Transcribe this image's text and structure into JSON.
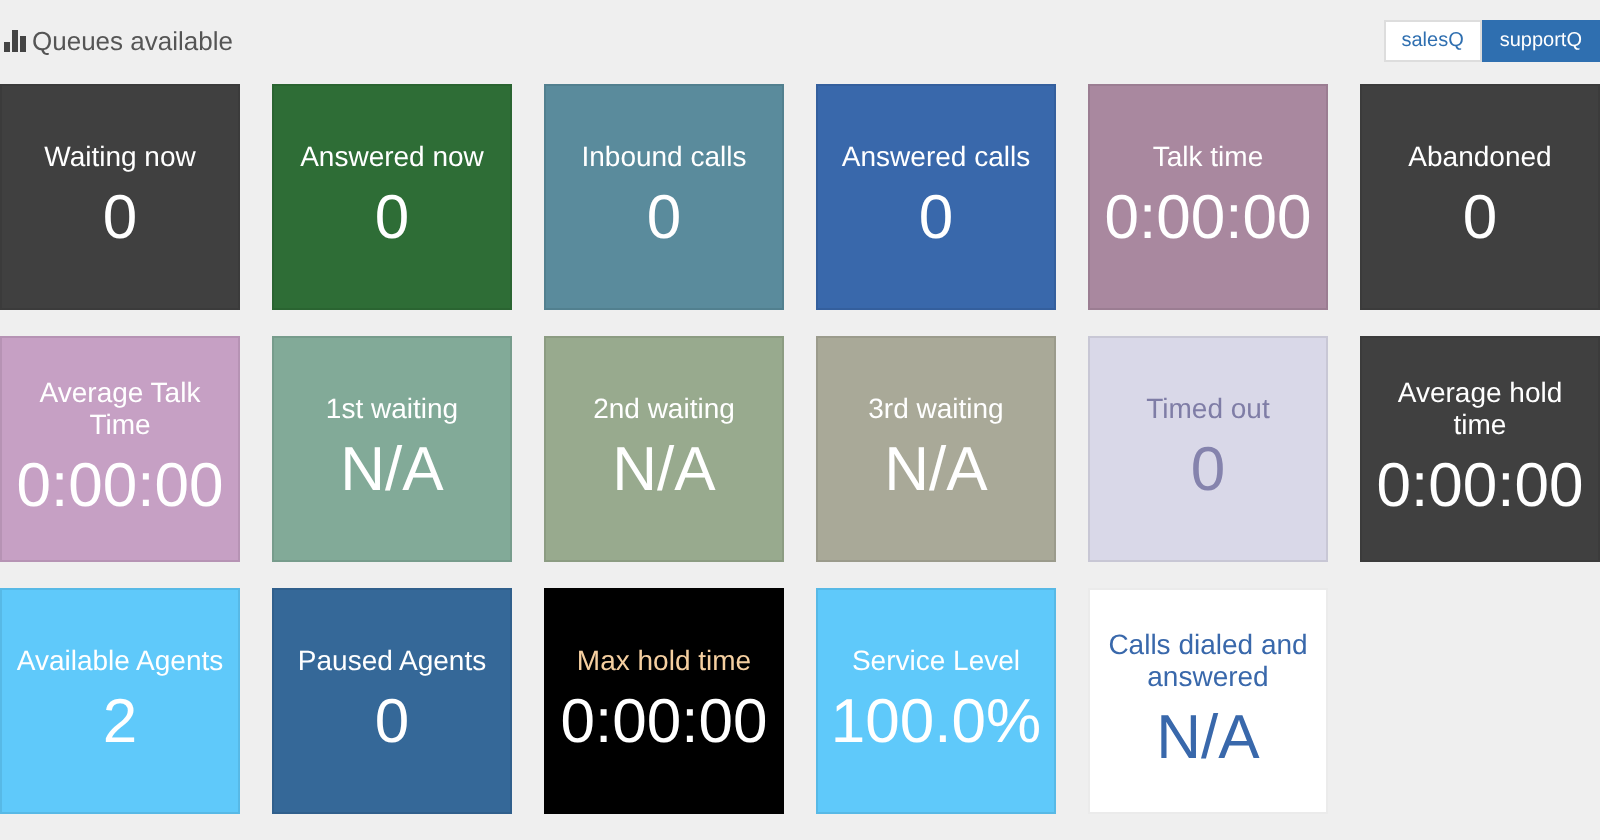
{
  "header": {
    "title": "Queues available"
  },
  "queues": [
    {
      "label": "salesQ",
      "selected": false
    },
    {
      "label": "supportQ",
      "selected": true
    }
  ],
  "tiles": [
    {
      "label": "Waiting now",
      "value": "0",
      "color": "#404040",
      "kind": "plain"
    },
    {
      "label": "Answered now",
      "value": "0",
      "color": "#2e6d36",
      "kind": "plain"
    },
    {
      "label": "Inbound calls",
      "value": "0",
      "color": "#5a8b9c",
      "kind": "plain"
    },
    {
      "label": "Answered calls",
      "value": "0",
      "color": "#3968ab",
      "kind": "plain"
    },
    {
      "label": "Talk time",
      "value": "0:00:00",
      "color": "#a9889f",
      "kind": "plain"
    },
    {
      "label": "Abandoned",
      "value": "0",
      "color": "#404040",
      "kind": "plain"
    },
    {
      "label": "Average Talk Time",
      "value": "0:00:00",
      "color": "#c6a0c4",
      "kind": "plain"
    },
    {
      "label": "1st waiting",
      "value": "N/A",
      "color": "#82aa98",
      "kind": "plain"
    },
    {
      "label": "2nd waiting",
      "value": "N/A",
      "color": "#98aa8e",
      "kind": "plain"
    },
    {
      "label": "3rd waiting",
      "value": "N/A",
      "color": "#a9a998",
      "kind": "plain"
    },
    {
      "label": "Timed out",
      "value": "0",
      "color": "#d9d8e8",
      "kind": "faint"
    },
    {
      "label": "Average hold time",
      "value": "0:00:00",
      "color": "#404040",
      "kind": "plain"
    },
    {
      "label": "Available Agents",
      "value": "2",
      "color": "#5fc9fa",
      "kind": "plain"
    },
    {
      "label": "Paused Agents",
      "value": "0",
      "color": "#356898",
      "kind": "plain"
    },
    {
      "label": "Max hold time",
      "value": "0:00:00",
      "color": "#000000",
      "kind": "warm"
    },
    {
      "label": "Service Level",
      "value": "100.0%",
      "color": "#5fc9fa",
      "kind": "plain"
    },
    {
      "label": "Calls dialed and answered",
      "value": "N/A",
      "color": "#ffffff",
      "kind": "light"
    }
  ]
}
